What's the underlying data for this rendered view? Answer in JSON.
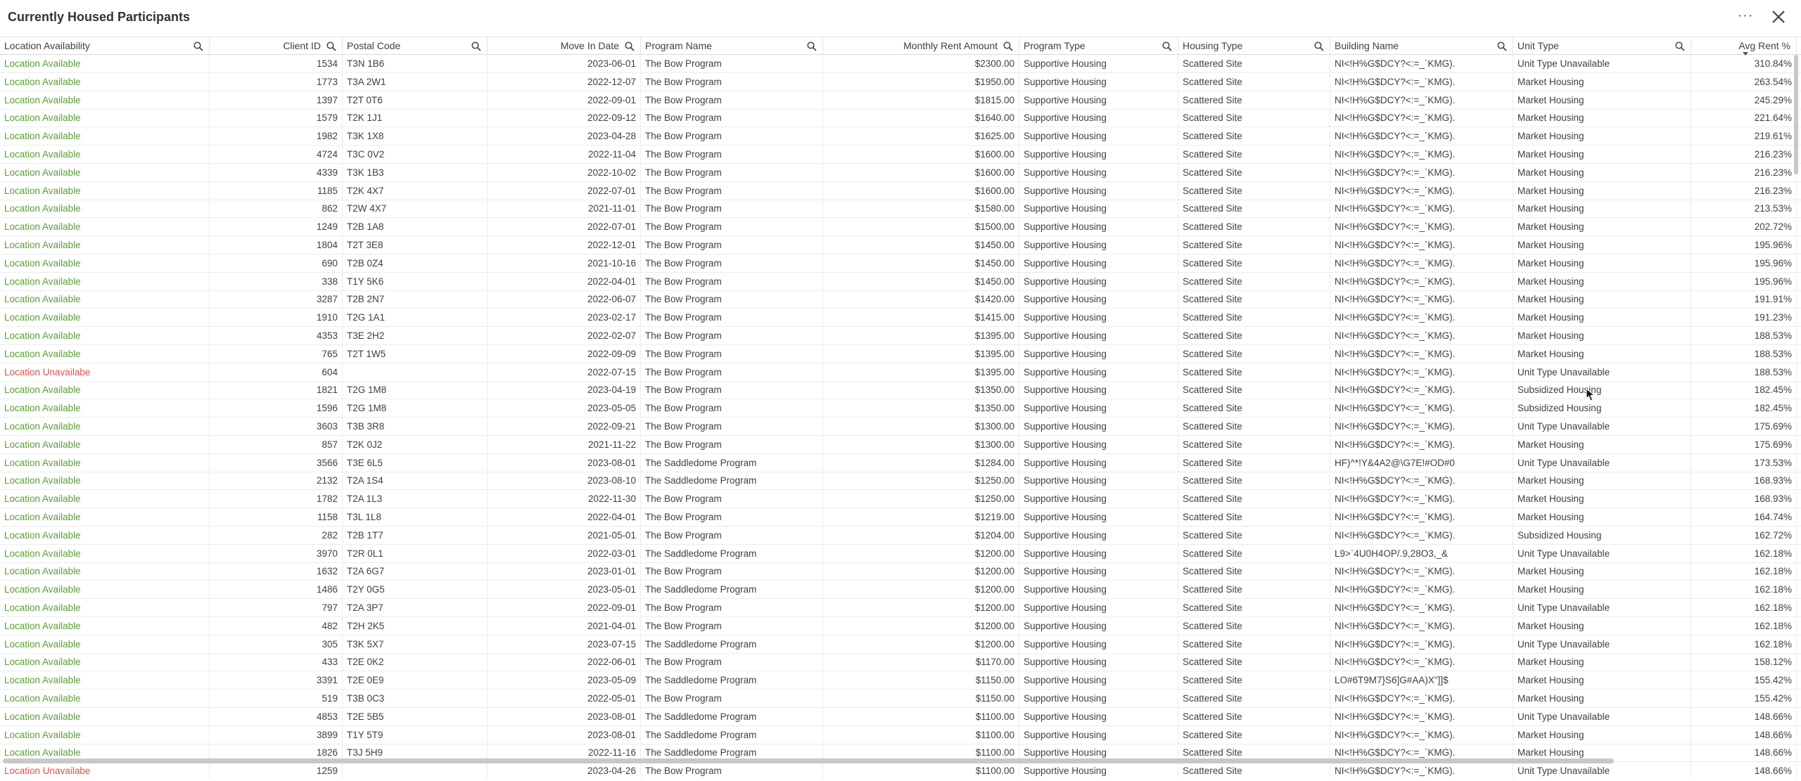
{
  "title": "Currently Housed Participants",
  "more_label": "···",
  "columns": [
    {
      "key": "loc",
      "label": "Location Availability",
      "align": "left",
      "searchable": true
    },
    {
      "key": "id",
      "label": "Client ID",
      "align": "right",
      "searchable": true
    },
    {
      "key": "postal",
      "label": "Postal Code",
      "align": "left",
      "searchable": true
    },
    {
      "key": "date",
      "label": "Move In Date",
      "align": "right",
      "searchable": true
    },
    {
      "key": "program",
      "label": "Program Name",
      "align": "left",
      "searchable": true
    },
    {
      "key": "rent",
      "label": "Monthly Rent Amount",
      "align": "right",
      "searchable": true
    },
    {
      "key": "ptype",
      "label": "Program Type",
      "align": "left",
      "searchable": true
    },
    {
      "key": "htype",
      "label": "Housing Type",
      "align": "left",
      "searchable": true
    },
    {
      "key": "bldg",
      "label": "Building Name",
      "align": "left",
      "searchable": true
    },
    {
      "key": "utype",
      "label": "Unit Type",
      "align": "left",
      "searchable": true
    },
    {
      "key": "avg",
      "label": "Avg Rent %",
      "align": "right",
      "searchable": false
    }
  ],
  "rows": [
    [
      "Location Available",
      "1534",
      "T3N 1B6",
      "2023-06-01",
      "The Bow Program",
      "$2300.00",
      "Supportive Housing",
      "Scattered Site",
      "NI<!H%G$DCY?<:=_`KMG).",
      "Unit Type Unavailable",
      "310.84%"
    ],
    [
      "Location Available",
      "1773",
      "T3A 2W1",
      "2022-12-07",
      "The Bow Program",
      "$1950.00",
      "Supportive Housing",
      "Scattered Site",
      "NI<!H%G$DCY?<:=_`KMG).",
      "Market Housing",
      "263.54%"
    ],
    [
      "Location Available",
      "1397",
      "T2T 0T6",
      "2022-09-01",
      "The Bow Program",
      "$1815.00",
      "Supportive Housing",
      "Scattered Site",
      "NI<!H%G$DCY?<:=_`KMG).",
      "Market Housing",
      "245.29%"
    ],
    [
      "Location Available",
      "1579",
      "T2K 1J1",
      "2022-09-12",
      "The Bow Program",
      "$1640.00",
      "Supportive Housing",
      "Scattered Site",
      "NI<!H%G$DCY?<:=_`KMG).",
      "Market Housing",
      "221.64%"
    ],
    [
      "Location Available",
      "1982",
      "T3K 1X8",
      "2023-04-28",
      "The Bow Program",
      "$1625.00",
      "Supportive Housing",
      "Scattered Site",
      "NI<!H%G$DCY?<:=_`KMG).",
      "Market Housing",
      "219.61%"
    ],
    [
      "Location Available",
      "4724",
      "T3C 0V2",
      "2022-11-04",
      "The Bow Program",
      "$1600.00",
      "Supportive Housing",
      "Scattered Site",
      "NI<!H%G$DCY?<:=_`KMG).",
      "Market Housing",
      "216.23%"
    ],
    [
      "Location Available",
      "4339",
      "T3K 1B3",
      "2022-10-02",
      "The Bow Program",
      "$1600.00",
      "Supportive Housing",
      "Scattered Site",
      "NI<!H%G$DCY?<:=_`KMG).",
      "Market Housing",
      "216.23%"
    ],
    [
      "Location Available",
      "1185",
      "T2K 4X7",
      "2022-07-01",
      "The Bow Program",
      "$1600.00",
      "Supportive Housing",
      "Scattered Site",
      "NI<!H%G$DCY?<:=_`KMG).",
      "Market Housing",
      "216.23%"
    ],
    [
      "Location Available",
      "862",
      "T2W 4X7",
      "2021-11-01",
      "The Bow Program",
      "$1580.00",
      "Supportive Housing",
      "Scattered Site",
      "NI<!H%G$DCY?<:=_`KMG).",
      "Market Housing",
      "213.53%"
    ],
    [
      "Location Available",
      "1249",
      "T2B 1A8",
      "2022-07-01",
      "The Bow Program",
      "$1500.00",
      "Supportive Housing",
      "Scattered Site",
      "NI<!H%G$DCY?<:=_`KMG).",
      "Market Housing",
      "202.72%"
    ],
    [
      "Location Available",
      "1804",
      "T2T 3E8",
      "2022-12-01",
      "The Bow Program",
      "$1450.00",
      "Supportive Housing",
      "Scattered Site",
      "NI<!H%G$DCY?<:=_`KMG).",
      "Market Housing",
      "195.96%"
    ],
    [
      "Location Available",
      "690",
      "T2B 0Z4",
      "2021-10-16",
      "The Bow Program",
      "$1450.00",
      "Supportive Housing",
      "Scattered Site",
      "NI<!H%G$DCY?<:=_`KMG).",
      "Market Housing",
      "195.96%"
    ],
    [
      "Location Available",
      "338",
      "T1Y 5K6",
      "2022-04-01",
      "The Bow Program",
      "$1450.00",
      "Supportive Housing",
      "Scattered Site",
      "NI<!H%G$DCY?<:=_`KMG).",
      "Market Housing",
      "195.96%"
    ],
    [
      "Location Available",
      "3287",
      "T2B 2N7",
      "2022-06-07",
      "The Bow Program",
      "$1420.00",
      "Supportive Housing",
      "Scattered Site",
      "NI<!H%G$DCY?<:=_`KMG).",
      "Market Housing",
      "191.91%"
    ],
    [
      "Location Available",
      "1910",
      "T2G 1A1",
      "2023-02-17",
      "The Bow Program",
      "$1415.00",
      "Supportive Housing",
      "Scattered Site",
      "NI<!H%G$DCY?<:=_`KMG).",
      "Market Housing",
      "191.23%"
    ],
    [
      "Location Available",
      "4353",
      "T3E 2H2",
      "2022-02-07",
      "The Bow Program",
      "$1395.00",
      "Supportive Housing",
      "Scattered Site",
      "NI<!H%G$DCY?<:=_`KMG).",
      "Market Housing",
      "188.53%"
    ],
    [
      "Location Available",
      "765",
      "T2T 1W5",
      "2022-09-09",
      "The Bow Program",
      "$1395.00",
      "Supportive Housing",
      "Scattered Site",
      "NI<!H%G$DCY?<:=_`KMG).",
      "Market Housing",
      "188.53%"
    ],
    [
      "Location Unavailabe",
      "604",
      "",
      "2022-07-15",
      "The Bow Program",
      "$1395.00",
      "Supportive Housing",
      "Scattered Site",
      "NI<!H%G$DCY?<:=_`KMG).",
      "Unit Type Unavailable",
      "188.53%"
    ],
    [
      "Location Available",
      "1821",
      "T2G 1M8",
      "2023-04-19",
      "The Bow Program",
      "$1350.00",
      "Supportive Housing",
      "Scattered Site",
      "NI<!H%G$DCY?<:=_`KMG).",
      "Subsidized Housing",
      "182.45%"
    ],
    [
      "Location Available",
      "1596",
      "T2G 1M8",
      "2023-05-05",
      "The Bow Program",
      "$1350.00",
      "Supportive Housing",
      "Scattered Site",
      "NI<!H%G$DCY?<:=_`KMG).",
      "Subsidized Housing",
      "182.45%"
    ],
    [
      "Location Available",
      "3603",
      "T3B 3R8",
      "2022-09-21",
      "The Bow Program",
      "$1300.00",
      "Supportive Housing",
      "Scattered Site",
      "NI<!H%G$DCY?<:=_`KMG).",
      "Unit Type Unavailable",
      "175.69%"
    ],
    [
      "Location Available",
      "857",
      "T2K 0J2",
      "2021-11-22",
      "The Bow Program",
      "$1300.00",
      "Supportive Housing",
      "Scattered Site",
      "NI<!H%G$DCY?<:=_`KMG).",
      "Market Housing",
      "175.69%"
    ],
    [
      "Location Available",
      "3566",
      "T3E 6L5",
      "2023-08-01",
      "The Saddledome Program",
      "$1284.00",
      "Supportive Housing",
      "Scattered Site",
      "HF)^*!Y&4A2@\\G7E!#OD#0",
      "Unit Type Unavailable",
      "173.53%"
    ],
    [
      "Location Available",
      "2132",
      "T2A 1S4",
      "2023-08-10",
      "The Saddledome Program",
      "$1250.00",
      "Supportive Housing",
      "Scattered Site",
      "NI<!H%G$DCY?<:=_`KMG).",
      "Market Housing",
      "168.93%"
    ],
    [
      "Location Available",
      "1782",
      "T2A 1L3",
      "2022-11-30",
      "The Bow Program",
      "$1250.00",
      "Supportive Housing",
      "Scattered Site",
      "NI<!H%G$DCY?<:=_`KMG).",
      "Market Housing",
      "168.93%"
    ],
    [
      "Location Available",
      "1158",
      "T3L 1L8",
      "2022-04-01",
      "The Bow Program",
      "$1219.00",
      "Supportive Housing",
      "Scattered Site",
      "NI<!H%G$DCY?<:=_`KMG).",
      "Market Housing",
      "164.74%"
    ],
    [
      "Location Available",
      "282",
      "T2B 1T7",
      "2021-05-01",
      "The Bow Program",
      "$1204.00",
      "Supportive Housing",
      "Scattered Site",
      "NI<!H%G$DCY?<:=_`KMG).",
      "Subsidized Housing",
      "162.72%"
    ],
    [
      "Location Available",
      "3970",
      "T2R 0L1",
      "2022-03-01",
      "The Saddledome Program",
      "$1200.00",
      "Supportive Housing",
      "Scattered Site",
      "L9>`4U0H4OP/.9,28O3,_&",
      "Unit Type Unavailable",
      "162.18%"
    ],
    [
      "Location Available",
      "1632",
      "T2A 6G7",
      "2023-01-01",
      "The Bow Program",
      "$1200.00",
      "Supportive Housing",
      "Scattered Site",
      "NI<!H%G$DCY?<:=_`KMG).",
      "Market Housing",
      "162.18%"
    ],
    [
      "Location Available",
      "1486",
      "T2Y 0G5",
      "2023-05-01",
      "The Saddledome Program",
      "$1200.00",
      "Supportive Housing",
      "Scattered Site",
      "NI<!H%G$DCY?<:=_`KMG).",
      "Market Housing",
      "162.18%"
    ],
    [
      "Location Available",
      "797",
      "T2A 3P7",
      "2022-09-01",
      "The Bow Program",
      "$1200.00",
      "Supportive Housing",
      "Scattered Site",
      "NI<!H%G$DCY?<:=_`KMG).",
      "Unit Type Unavailable",
      "162.18%"
    ],
    [
      "Location Available",
      "482",
      "T2H 2K5",
      "2021-04-01",
      "The Bow Program",
      "$1200.00",
      "Supportive Housing",
      "Scattered Site",
      "NI<!H%G$DCY?<:=_`KMG).",
      "Market Housing",
      "162.18%"
    ],
    [
      "Location Available",
      "305",
      "T3K 5X7",
      "2023-07-15",
      "The Saddledome Program",
      "$1200.00",
      "Supportive Housing",
      "Scattered Site",
      "NI<!H%G$DCY?<:=_`KMG).",
      "Unit Type Unavailable",
      "162.18%"
    ],
    [
      "Location Available",
      "433",
      "T2E 0K2",
      "2022-06-01",
      "The Bow Program",
      "$1170.00",
      "Supportive Housing",
      "Scattered Site",
      "NI<!H%G$DCY?<:=_`KMG).",
      "Market Housing",
      "158.12%"
    ],
    [
      "Location Available",
      "3391",
      "T2E 0E9",
      "2023-05-09",
      "The Saddledome Program",
      "$1150.00",
      "Supportive Housing",
      "Scattered Site",
      "LO#6T9M7}S6]G#AA)X\"]]$",
      "Market Housing",
      "155.42%"
    ],
    [
      "Location Available",
      "519",
      "T3B 0C3",
      "2022-05-01",
      "The Bow Program",
      "$1150.00",
      "Supportive Housing",
      "Scattered Site",
      "NI<!H%G$DCY?<:=_`KMG).",
      "Market Housing",
      "155.42%"
    ],
    [
      "Location Available",
      "4853",
      "T2E 5B5",
      "2023-08-01",
      "The Saddledome Program",
      "$1100.00",
      "Supportive Housing",
      "Scattered Site",
      "NI<!H%G$DCY?<:=_`KMG).",
      "Unit Type Unavailable",
      "148.66%"
    ],
    [
      "Location Available",
      "3899",
      "T1Y 5T9",
      "2023-08-01",
      "The Saddledome Program",
      "$1100.00",
      "Supportive Housing",
      "Scattered Site",
      "NI<!H%G$DCY?<:=_`KMG).",
      "Market Housing",
      "148.66%"
    ],
    [
      "Location Available",
      "1826",
      "T3J 5H9",
      "2022-11-16",
      "The Saddledome Program",
      "$1100.00",
      "Supportive Housing",
      "Scattered Site",
      "NI<!H%G$DCY?<:=_`KMG).",
      "Market Housing",
      "148.66%"
    ],
    [
      "Location Unavailabe",
      "1259",
      "",
      "2023-04-26",
      "The Bow Program",
      "$1100.00",
      "Supportive Housing",
      "Scattered Site",
      "NI<!H%G$DCY?<:=_`KMG).",
      "Unit Type Unavailable",
      "148.66%"
    ]
  ],
  "colors": {
    "available": "#5a9e36",
    "unavailable": "#d9534f",
    "border": "#e3e3e3"
  }
}
